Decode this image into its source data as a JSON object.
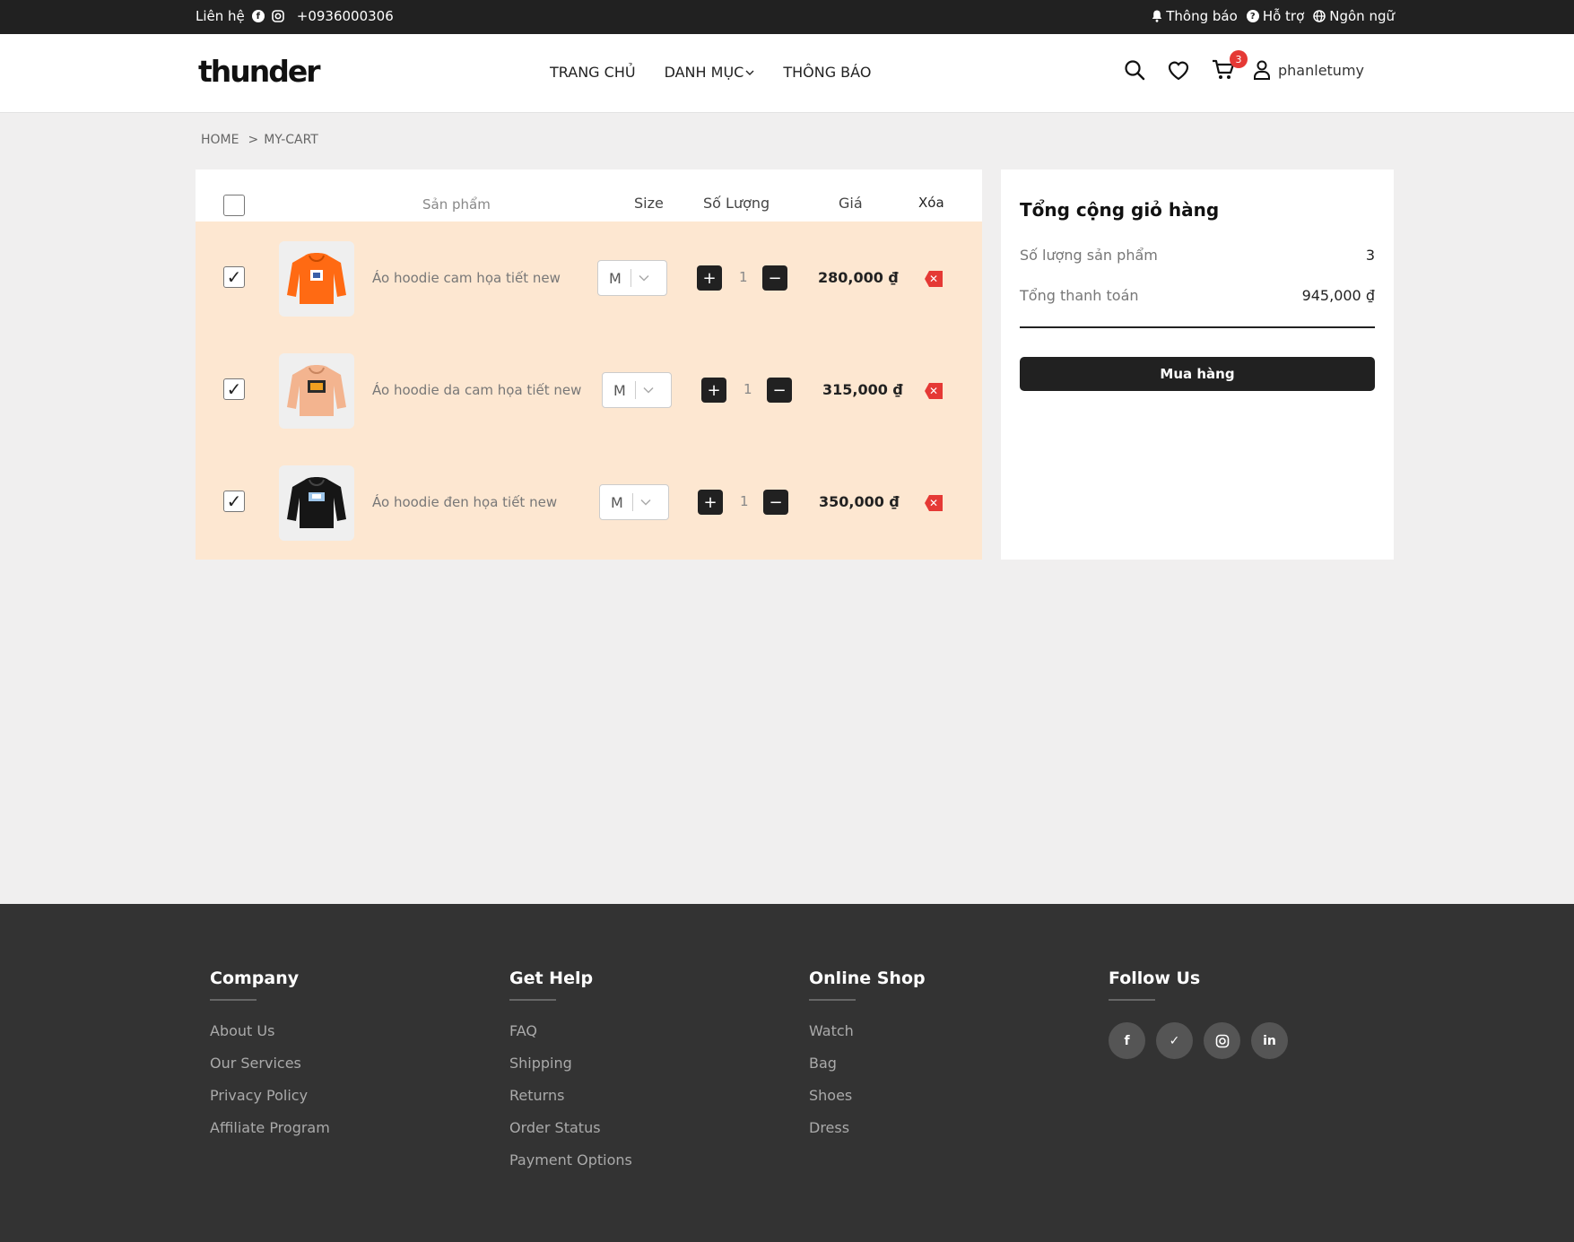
{
  "topbar": {
    "contact_label": "Liên hệ",
    "phone": "+0936000306",
    "notifications": "Thông báo",
    "support": "Hỗ trợ",
    "language": "Ngôn ngữ"
  },
  "header": {
    "logo": "thunder",
    "nav": [
      "TRANG CHỦ",
      "DANH MỤC",
      "THÔNG BÁO"
    ],
    "cart_count": "3",
    "username": "phanletumy"
  },
  "breadcrumb": [
    "HOME",
    ">",
    "MY-CART"
  ],
  "cart": {
    "columns": {
      "product": "Sản phẩm",
      "size": "Size",
      "quantity": "Số Lượng",
      "price": "Giá",
      "delete": "Xóa"
    },
    "items": [
      {
        "name": "Áo hoodie cam họa tiết new",
        "size": "M",
        "qty": "1",
        "price": "280,000 ₫",
        "color": "#ff6a13",
        "checked": true
      },
      {
        "name": "Áo hoodie da cam họa tiết new",
        "size": "M",
        "qty": "1",
        "price": "315,000 ₫",
        "color": "#f3b48f",
        "checked": true
      },
      {
        "name": "Áo hoodie đen họa tiết new",
        "size": "M",
        "qty": "1",
        "price": "350,000 ₫",
        "color": "#161616",
        "checked": true
      }
    ]
  },
  "summary": {
    "title": "Tổng cộng giỏ hàng",
    "count_label": "Số lượng sản phẩm",
    "count_value": "3",
    "total_label": "Tổng thanh toán",
    "total_value": "945,000 ₫",
    "buy_button": "Mua hàng"
  },
  "footer": {
    "company": {
      "title": "Company",
      "links": [
        "About Us",
        "Our Services",
        "Privacy Policy",
        "Affiliate Program"
      ]
    },
    "help": {
      "title": "Get Help",
      "links": [
        "FAQ",
        "Shipping",
        "Returns",
        "Order Status",
        "Payment Options"
      ]
    },
    "shop": {
      "title": "Online Shop",
      "links": [
        "Watch",
        "Bag",
        "Shoes",
        "Dress"
      ]
    },
    "follow": {
      "title": "Follow Us",
      "icons": [
        "facebook-icon",
        "twitter-icon",
        "instagram-icon",
        "linkedin-icon"
      ]
    }
  }
}
